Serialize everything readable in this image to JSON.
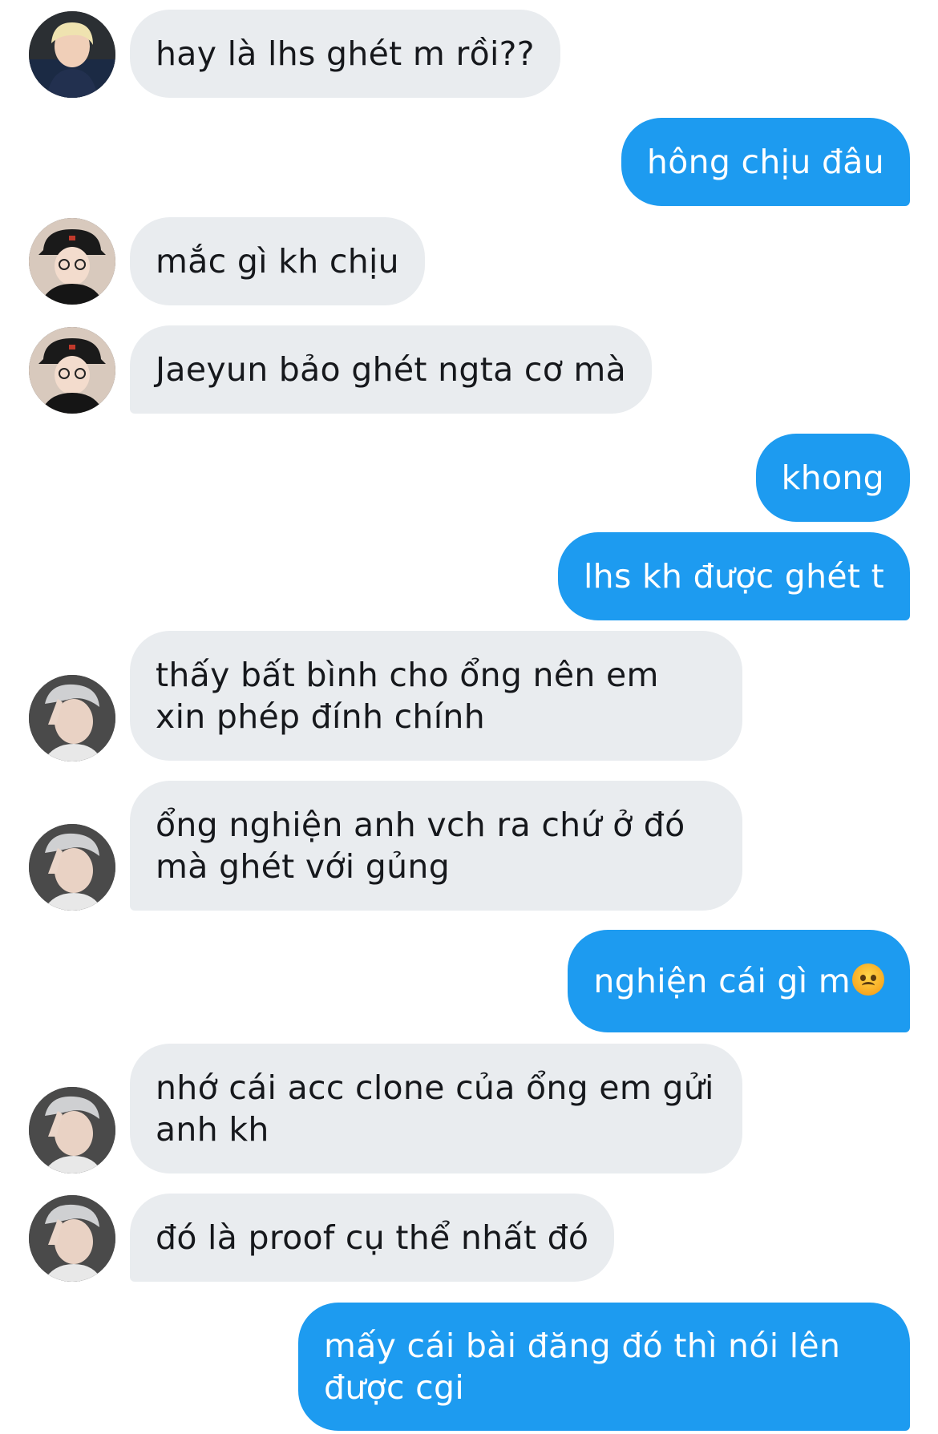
{
  "messages": [
    {
      "side": "in",
      "avatar": "blonde-avatar",
      "text": "hay là lhs ghét m rồi??"
    },
    {
      "side": "out",
      "text": "hông chịu đâu"
    },
    {
      "side": "in",
      "avatar": "cap-avatar",
      "text": "mắc gì kh chịu"
    },
    {
      "side": "in",
      "avatar": "cap-avatar",
      "text": "Jaeyun bảo ghét ngta cơ mà"
    },
    {
      "side": "out",
      "text": "khong"
    },
    {
      "side": "out",
      "text": "lhs kh được ghét t"
    },
    {
      "side": "in",
      "avatar": "peace-sign-avatar",
      "text": "thấy bất bình cho ổng nên em xin phép đính chính"
    },
    {
      "side": "in",
      "avatar": "peace-sign-avatar",
      "text": "ổng nghiện anh vch ra chứ ở đó mà ghét với gủng"
    },
    {
      "side": "out",
      "text": "nghiện cái gì m",
      "emoji": "angry-face-icon"
    },
    {
      "side": "in",
      "avatar": "peace-sign-avatar",
      "text": "nhớ cái acc clone của ổng em gửi anh kh"
    },
    {
      "side": "in",
      "avatar": "peace-sign-avatar",
      "text": "đó là proof cụ thể nhất đó"
    },
    {
      "side": "out",
      "text": "mấy cái bài đăng đó thì nói lên được cgi"
    }
  ],
  "colors": {
    "incoming_bubble": "#e9ecef",
    "outgoing_bubble": "#1d9bf0",
    "incoming_text": "#16181c",
    "outgoing_text": "#ffffff"
  }
}
